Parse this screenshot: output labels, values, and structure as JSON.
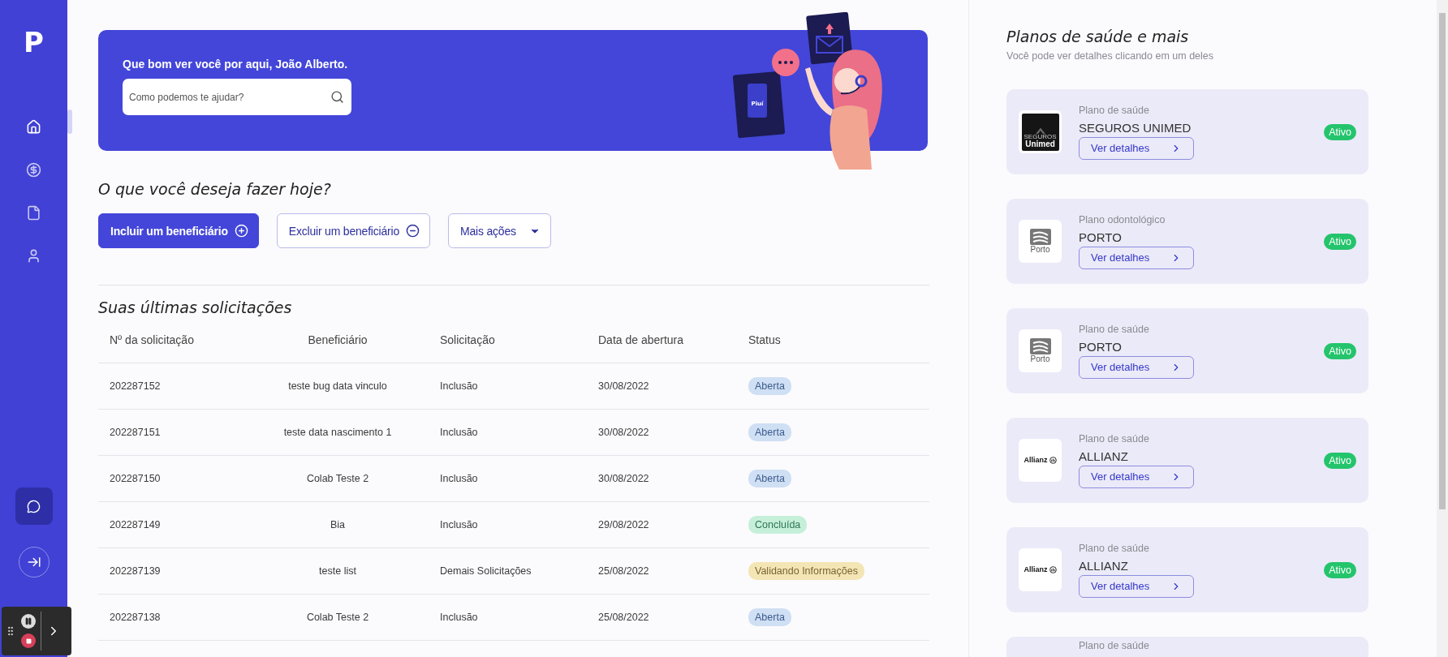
{
  "sidebar": {
    "logo": "P",
    "items": [
      {
        "kind": "home",
        "selected": true
      },
      {
        "kind": "dollar",
        "selected": false
      },
      {
        "kind": "file",
        "selected": false
      },
      {
        "kind": "user",
        "selected": false
      }
    ]
  },
  "banner": {
    "greeting": "Que bom ver você por aqui, João Alberto.",
    "search": {
      "placeholder": "Como podemos te ajudar?"
    },
    "phone_label": "Piuí"
  },
  "actions": {
    "title": "O que você deseja fazer hoje?",
    "buttons": [
      {
        "label": "Incluir um beneficiário",
        "kind": "primary"
      },
      {
        "label": "Excluir um beneficiário",
        "kind": "remove"
      },
      {
        "label": "Mais ações",
        "kind": "dropdown"
      }
    ]
  },
  "requests": {
    "title": "Suas últimas solicitações",
    "columns": [
      "Nº da solicitação",
      "Beneficiário",
      "Solicitação",
      "Data de abertura",
      "Status"
    ],
    "rows": [
      {
        "number": "202287152",
        "beneficiary": "teste bug data vinculo",
        "request": "Inclusão",
        "date": "30/08/2022",
        "status": "Aberta",
        "kind": "open"
      },
      {
        "number": "202287151",
        "beneficiary": "teste data nascimento 1",
        "request": "Inclusão",
        "date": "30/08/2022",
        "status": "Aberta",
        "kind": "open"
      },
      {
        "number": "202287150",
        "beneficiary": "Colab Teste 2",
        "request": "Inclusão",
        "date": "30/08/2022",
        "status": "Aberta",
        "kind": "open"
      },
      {
        "number": "202287149",
        "beneficiary": "Bia",
        "request": "Inclusão",
        "date": "29/08/2022",
        "status": "Concluída",
        "kind": "done"
      },
      {
        "number": "202287139",
        "beneficiary": "teste list",
        "request": "Demais Solicitações",
        "date": "25/08/2022",
        "status": "Validando Informações",
        "kind": "validating"
      },
      {
        "number": "202287138",
        "beneficiary": "Colab Teste 2",
        "request": "Inclusão",
        "date": "25/08/2022",
        "status": "Aberta",
        "kind": "open"
      }
    ]
  },
  "plans": {
    "title": "Planos de saúde e mais",
    "subtitle": "Você pode ver detalhes clicando em um deles",
    "items": [
      {
        "type": "Plano de saúde",
        "name": "SEGUROS UNIMED",
        "logo": {
          "kind": "unimed",
          "lines": [
            "SEGUROS",
            "Unimed"
          ]
        },
        "button": "Ver detalhes",
        "status": "Ativo"
      },
      {
        "type": "Plano odontológico",
        "name": "PORTO",
        "logo": {
          "kind": "porto",
          "lines": [
            "Porto"
          ]
        },
        "button": "Ver detalhes",
        "status": "Ativo"
      },
      {
        "type": "Plano de saúde",
        "name": "PORTO",
        "logo": {
          "kind": "porto",
          "lines": [
            "Porto"
          ]
        },
        "button": "Ver detalhes",
        "status": "Ativo"
      },
      {
        "type": "Plano de saúde",
        "name": "ALLIANZ",
        "logo": {
          "kind": "allianz",
          "lines": [
            "Allianz"
          ]
        },
        "button": "Ver detalhes",
        "status": "Ativo"
      },
      {
        "type": "Plano de saúde",
        "name": "ALLIANZ",
        "logo": {
          "kind": "allianz",
          "lines": [
            "Allianz"
          ]
        },
        "button": "Ver detalhes",
        "status": "Ativo"
      },
      {
        "type": "Plano de saúde"
      }
    ]
  }
}
